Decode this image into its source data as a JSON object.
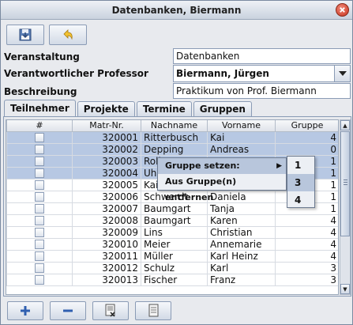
{
  "window": {
    "title": "Datenbanken, Biermann"
  },
  "toolbar": {
    "save_icon": "save-icon",
    "undo_icon": "undo-icon"
  },
  "form": {
    "veranstaltung_label": "Veranstaltung",
    "veranstaltung_value": "Datenbanken",
    "professor_label": "Verantwortlicher Professor",
    "professor_value": "Biermann, Jürgen",
    "beschreibung_label": "Beschreibung",
    "beschreibung_value": "Praktikum von Prof. Biermann"
  },
  "tabs": [
    {
      "label": "Teilnehmer"
    },
    {
      "label": "Projekte"
    },
    {
      "label": "Termine"
    },
    {
      "label": "Gruppen"
    }
  ],
  "table": {
    "headers": [
      "#",
      "Matr-Nr.",
      "Nachname",
      "Vorname",
      "Gruppe"
    ],
    "rows": [
      {
        "matr": "320001",
        "nachname": "Ritterbusch",
        "vorname": "Kai",
        "gruppe": "4",
        "selected": true
      },
      {
        "matr": "320002",
        "nachname": "Depping",
        "vorname": "Andreas",
        "gruppe": "0",
        "selected": true
      },
      {
        "matr": "320003",
        "nachname": "Rolh",
        "vorname": "",
        "gruppe": "1",
        "selected": true
      },
      {
        "matr": "320004",
        "nachname": "Uhle",
        "vorname": "",
        "gruppe": "1",
        "selected": true
      },
      {
        "matr": "320005",
        "nachname": "Kailb",
        "vorname": "",
        "gruppe": "1",
        "selected": false
      },
      {
        "matr": "320006",
        "nachname": "Schwerdt",
        "vorname": "Daniela",
        "gruppe": "1",
        "selected": false
      },
      {
        "matr": "320007",
        "nachname": "Baumgart",
        "vorname": "Tanja",
        "gruppe": "1",
        "selected": false
      },
      {
        "matr": "320008",
        "nachname": "Baumgart",
        "vorname": "Karen",
        "gruppe": "4",
        "selected": false
      },
      {
        "matr": "320009",
        "nachname": "Lins",
        "vorname": "Christian",
        "gruppe": "4",
        "selected": false
      },
      {
        "matr": "320010",
        "nachname": "Meier",
        "vorname": "Annemarie",
        "gruppe": "4",
        "selected": false
      },
      {
        "matr": "320011",
        "nachname": "Müller",
        "vorname": "Karl Heinz",
        "gruppe": "4",
        "selected": false
      },
      {
        "matr": "320012",
        "nachname": "Schulz",
        "vorname": "Karl",
        "gruppe": "3",
        "selected": false
      },
      {
        "matr": "320013",
        "nachname": "Fischer",
        "vorname": "Franz",
        "gruppe": "3",
        "selected": false
      }
    ]
  },
  "context_menu": {
    "items": [
      {
        "label": "Gruppe setzen:",
        "has_submenu": true,
        "highlighted": true
      },
      {
        "label": "Aus Gruppe(n) entfernen",
        "has_submenu": false,
        "highlighted": false
      }
    ],
    "submenu": [
      {
        "label": "1",
        "highlighted": false
      },
      {
        "label": "3",
        "highlighted": true
      },
      {
        "label": "4",
        "highlighted": false
      }
    ]
  },
  "bottom_toolbar": {
    "add_icon": "plus-icon",
    "remove_icon": "minus-icon",
    "export_icon": "export-document-icon",
    "document_icon": "document-icon"
  },
  "colors": {
    "selection": "#b7c8e3",
    "menu_highlight": "#b8c6dc",
    "close": "#c8321c"
  }
}
